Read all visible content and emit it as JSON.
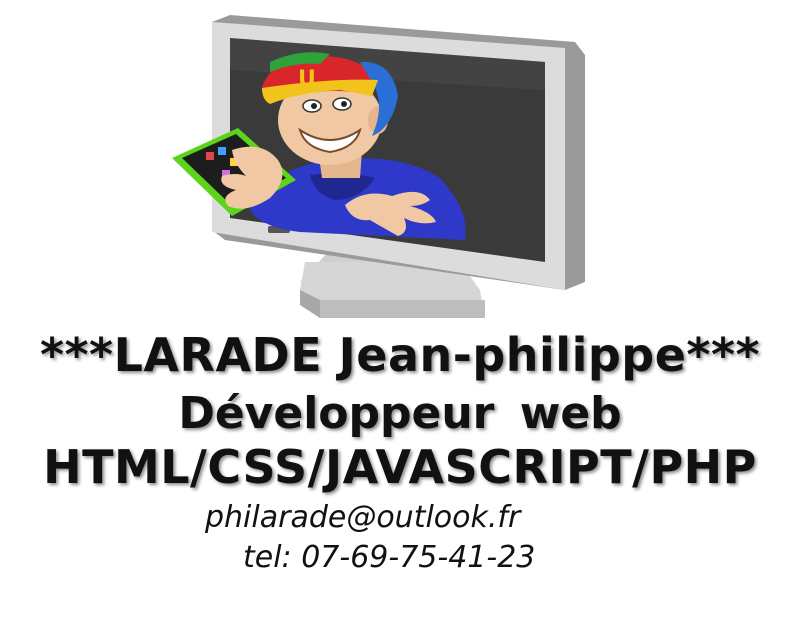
{
  "header": {
    "name": "***LARADE Jean-philippe***",
    "role": "Développeur web",
    "skills": "HTML/CSS/JAVASCRIPT/PHP"
  },
  "contact": {
    "email": "philarade@outlook.fr",
    "phone": "tel:  07-69-75-41-23"
  },
  "illustration": {
    "monitor_frame": "#d9d9d9",
    "screen": "#3a3a3a",
    "cap_red": "#d8262a",
    "cap_blue": "#2a6fd6",
    "hoodie": "#2f39c9",
    "skin": "#f0c9a4",
    "tablet_green": "#5ed31c",
    "cap_logo": "U"
  }
}
